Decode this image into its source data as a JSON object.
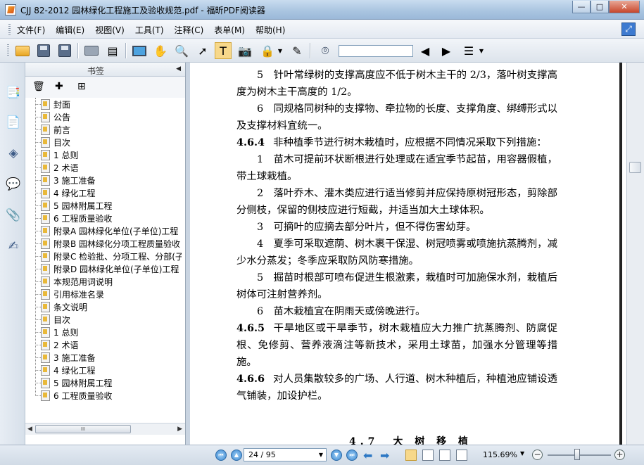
{
  "window": {
    "title": "CJJ 82-2012 园林绿化工程施工及验收规范.pdf - 福昕PDF阅读器",
    "min_glyph": "—",
    "max_glyph": "□",
    "close_glyph": "✕"
  },
  "menu": {
    "items": [
      "文件(F)",
      "编辑(E)",
      "视图(V)",
      "工具(T)",
      "注释(C)",
      "表单(M)",
      "帮助(H)"
    ]
  },
  "toolbar": {
    "find_value": "",
    "icons": [
      "open-folder-icon",
      "save-icon",
      "save-as-icon",
      "print-icon",
      "scan-icon",
      "fullscreen-icon",
      "hand-icon",
      "zoom-icon",
      "select-icon",
      "text-select-icon",
      "snapshot-icon",
      "rms-icon",
      "sign-icon",
      "find-icon",
      "find-prev-icon",
      "find-next-icon",
      "settings-icon"
    ]
  },
  "sidebar": {
    "title": "书签",
    "collapse_glyph": "◀",
    "bookmarks": [
      "封面",
      "公告",
      "前言",
      "目次",
      "1 总则",
      "2 术语",
      "3 施工准备",
      "4 绿化工程",
      "5 园林附属工程",
      "6 工程质量验收",
      "附录A 园林绿化单位(子单位)工程",
      "附录B 园林绿化分项工程质量验收",
      "附录C 检验批、分项工程、分部(子",
      "附录D 园林绿化单位(子单位)工程",
      "本规范用词说明",
      "引用标准名录",
      "条文说明",
      "目次",
      "1 总则",
      "2 术语",
      "3 施工准备",
      "4 绿化工程",
      "5 园林附属工程",
      "6 工程质量验收"
    ],
    "hscroll_thumb": "III",
    "left_arrow": "◀",
    "right_arrow": "▶"
  },
  "document": {
    "paragraphs": [
      {
        "num": "",
        "text": "5　针叶常绿树的支撑高度应不低于树木主干的 2/3，落叶树支撑高度为树木主干高度的 1/2。",
        "indent": true
      },
      {
        "num": "",
        "text": "6　同规格同树种的支撑物、牵拉物的长度、支撑角度、绑缚形式以及支撑材料宜统一。",
        "indent": true
      },
      {
        "num": "4.6.4",
        "text": "非种植季节进行树木栽植时，应根据不同情况采取下列措施：",
        "indent": false
      },
      {
        "num": "",
        "text": "1　苗木可提前环状断根进行处理或在适宜季节起苗，用容器假植，带土球栽植。",
        "indent": true
      },
      {
        "num": "",
        "text": "2　落叶乔木、灌木类应进行适当修剪并应保持原树冠形态，剪除部分侧枝，保留的侧枝应进行短截，并适当加大土球体积。",
        "indent": true
      },
      {
        "num": "",
        "text": "3　可摘叶的应摘去部分叶片，但不得伤害幼芽。",
        "indent": true
      },
      {
        "num": "",
        "text": "4　夏季可采取遮荫、树木裹干保湿、树冠喷雾或喷施抗蒸腾剂，减少水分蒸发；冬季应采取防风防寒措施。",
        "indent": true
      },
      {
        "num": "",
        "text": "5　掘苗时根部可喷布促进生根激素，栽植时可加施保水剂，栽植后树体可注射营养剂。",
        "indent": true
      },
      {
        "num": "",
        "text": "6　苗木栽植宜在阴雨天或傍晚进行。",
        "indent": true
      },
      {
        "num": "4.6.5",
        "text": "干旱地区或干旱季节，树木栽植应大力推广抗蒸腾剂、防腐促根、免修剪、营养液滴注等新技术，采用土球苗，加强水分管理等措施。",
        "indent": false
      },
      {
        "num": "4.6.6",
        "text": "对人员集散较多的广场、人行道、树木种植后，种植池应铺设透气铺装，加设护栏。",
        "indent": false
      }
    ],
    "next_heading": "4.7　大 树 移 植"
  },
  "statusbar": {
    "page_value": "24 / 95",
    "zoom_value": "115.69%",
    "zoom_minus": "−",
    "zoom_plus": "+",
    "drop_glyph": "▼"
  }
}
